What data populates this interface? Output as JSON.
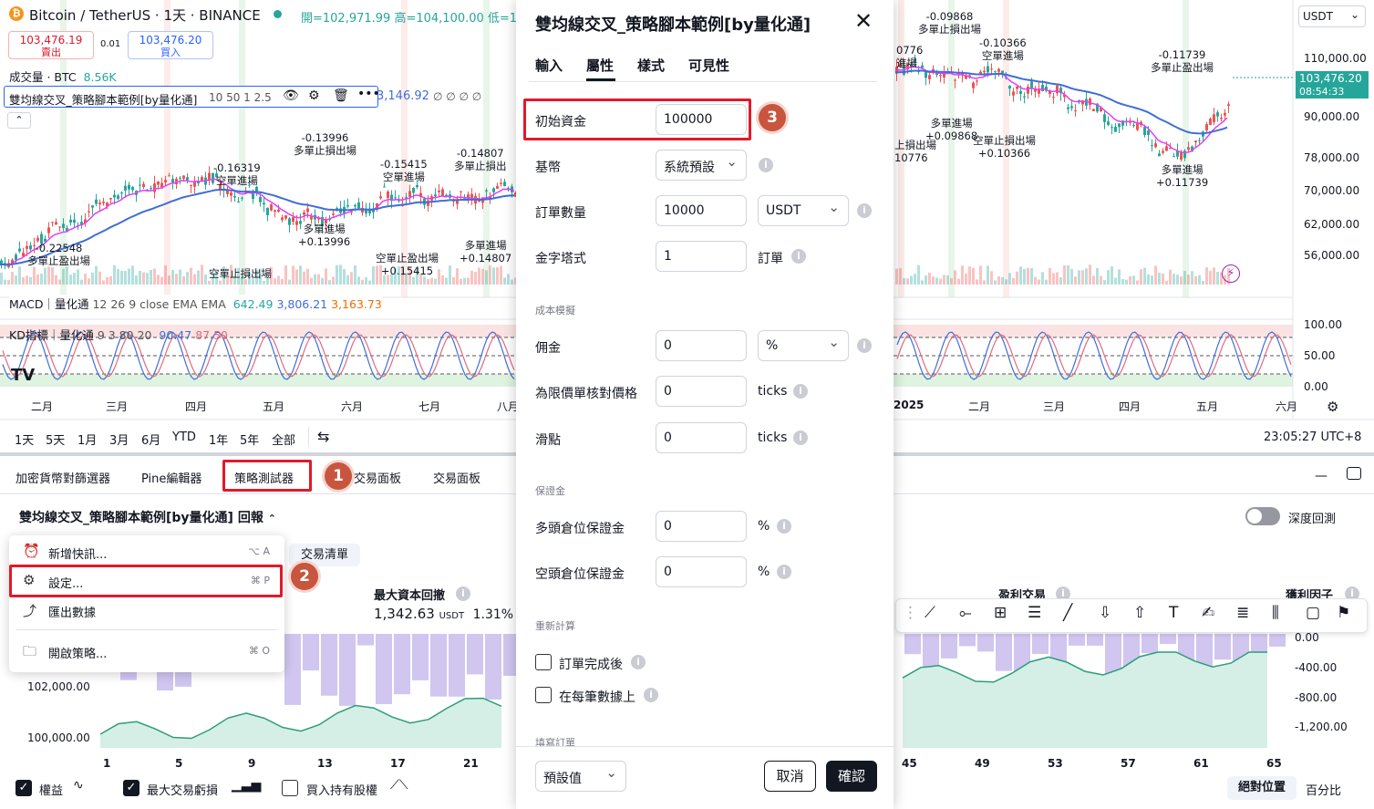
{
  "header": {
    "logo": "bitcoin-icon",
    "symbol": "Bitcoin / TetherUS · 1天 · BINANCE",
    "ohlc": "開=102,971.99 高=104,100.00 低=1",
    "sell_price": "103,476.19",
    "sell_label": "賣出",
    "spread": "0.01",
    "buy_price": "103,476.20",
    "buy_label": "買入",
    "volume_label": "成交量 · BTC",
    "volume_value": "8.56K"
  },
  "legend": {
    "strategy": "雙均線交叉_策略腳本範例[by量化通]",
    "params": "10 50 1 2.5",
    "value": "3,146.92",
    "nulls": "∅ ∅ ∅ ∅",
    "macd_name": "MACD｜量化通",
    "macd_params": "12 26 9 close EMA EMA",
    "macd_v1": "642.49",
    "macd_v2": "3,806.21",
    "macd_v3": "3,163.73",
    "kd_name": "KD指標｜量化通",
    "kd_params": "9 3 80 20",
    "kd_v1": "90.47",
    "kd_v2": "87.50"
  },
  "annotations": [
    {
      "id": "a1",
      "text": "-0.22548\n多單止盈出場"
    },
    {
      "id": "a2",
      "text": "-0.16319\n空單進場"
    },
    {
      "id": "a3",
      "text": "-0.13996\n多單止損出場"
    },
    {
      "id": "a4",
      "text": "-0.15415\n空單進場"
    },
    {
      "id": "a5",
      "text": "-0.14807\n多單止損出"
    },
    {
      "id": "a6",
      "text": "多單進場\n+0.13996"
    },
    {
      "id": "a7",
      "text": "空單止損出場"
    },
    {
      "id": "a8",
      "text": "空單止盈出場\n+0.15415"
    },
    {
      "id": "a9",
      "text": "多單進場\n+0.14807"
    },
    {
      "id": "a10",
      "text": "-0.09868\n多單止損出場"
    },
    {
      "id": "a11",
      "text": "0776\n進場"
    },
    {
      "id": "a12",
      "text": "-0.10366\n空單進場"
    },
    {
      "id": "a13",
      "text": "-0.11739\n多單止盈出場"
    },
    {
      "id": "a14",
      "text": "多單進場\n+0.09868"
    },
    {
      "id": "a15",
      "text": "上損出場\n10776"
    },
    {
      "id": "a16",
      "text": "空單止損出場\n+0.10366"
    },
    {
      "id": "a17",
      "text": "多單進場\n+0.11739"
    }
  ],
  "price_axis": [
    "110,000.00",
    "90,000.00",
    "78,000.00",
    "70,000.00",
    "62,000.00",
    "56,000.00"
  ],
  "price_tag": {
    "price": "103,476.20",
    "time": "08:54:33"
  },
  "quote_currency": "USDT",
  "kd_axis": [
    "100.00",
    "50.00",
    "0.00"
  ],
  "time_axis_left": [
    "二月",
    "三月",
    "四月",
    "五月",
    "六月",
    "七月",
    "八月"
  ],
  "time_axis_right": [
    "2025",
    "二月",
    "三月",
    "四月",
    "五月",
    "六月"
  ],
  "ranges": [
    "1天",
    "5天",
    "1月",
    "3月",
    "6月",
    "YTD",
    "1年",
    "5年",
    "全部"
  ],
  "clock": "23:05:27 UTC+8",
  "bottom_tabs": [
    "加密貨幣對篩選器",
    "Pine編輯器",
    "策略測試器",
    "交易面板",
    "交易面板"
  ],
  "report": {
    "title": "雙均線交叉_策略腳本範例[by量化通] 回報",
    "trade_list_tab": "交易清單",
    "deep_backtest": "深度回測",
    "max_drawdown_label": "最大資本回撤",
    "max_drawdown_value": "1,342.63",
    "max_drawdown_unit": "USDT",
    "max_drawdown_pct": "1.31%",
    "win_trades_label": "盈利交易",
    "profit_factor_label": "獲利因子"
  },
  "menu": [
    {
      "label": "新增快訊...",
      "shortcut": "⌥ A",
      "icon": "alarm-icon"
    },
    {
      "label": "設定...",
      "shortcut": "⌘ P",
      "icon": "gear-icon"
    },
    {
      "label": "匯出數據",
      "shortcut": "",
      "icon": "export-icon"
    },
    {
      "label": "開啟策略...",
      "shortcut": "⌘ O",
      "icon": "folder-icon"
    }
  ],
  "equity_axis_left": [
    "102,000.00",
    "100,000.00"
  ],
  "equity_axis_right": [
    "0.00",
    "-400.00",
    "-800.00",
    "-1,200.00"
  ],
  "equity_x": [
    "1",
    "5",
    "9",
    "13",
    "17",
    "21",
    "45",
    "49",
    "53",
    "57",
    "61",
    "65"
  ],
  "footer": {
    "equity": "權益",
    "max_dd": "最大交易虧損",
    "buy_hold": "買入持有股權",
    "absolute": "絕對位置",
    "percent": "百分比"
  },
  "dialog": {
    "title": "雙均線交叉_策略腳本範例[by量化通]",
    "tabs": [
      "輸入",
      "屬性",
      "樣式",
      "可見性"
    ],
    "active_tab": "屬性",
    "initial_capital_label": "初始資金",
    "initial_capital": "100000",
    "base_currency_label": "基幣",
    "base_currency": "系統預設",
    "order_size_label": "訂單數量",
    "order_size": "10000",
    "order_size_unit": "USDT",
    "pyramiding_label": "金字塔式",
    "pyramiding": "1",
    "pyramiding_unit": "訂單",
    "cost_section": "成本模擬",
    "commission_label": "佣金",
    "commission": "0",
    "commission_unit": "%",
    "limit_verify_label": "為限價單核對價格",
    "limit_verify": "0",
    "limit_verify_unit": "ticks",
    "slippage_label": "滑點",
    "slippage": "0",
    "slippage_unit": "ticks",
    "margin_section": "保證金",
    "long_margin_label": "多頭倉位保證金",
    "long_margin": "0",
    "long_margin_unit": "%",
    "short_margin_label": "空頭倉位保證金",
    "short_margin": "0",
    "short_margin_unit": "%",
    "recalc_section": "重新計算",
    "after_fill_label": "訂單完成後",
    "every_tick_label": "在每筆數據上",
    "fill_section": "填寫訂單",
    "defaults": "預設值",
    "cancel": "取消",
    "ok": "確認"
  },
  "callouts": [
    "1",
    "2",
    "3"
  ],
  "colors": {
    "up": "#26a69a",
    "down": "#ef5350",
    "ema_fast": "#e040fb",
    "ema_slow": "#3f6ed8",
    "accent": "#e0192b",
    "badge": "#c8553d"
  }
}
